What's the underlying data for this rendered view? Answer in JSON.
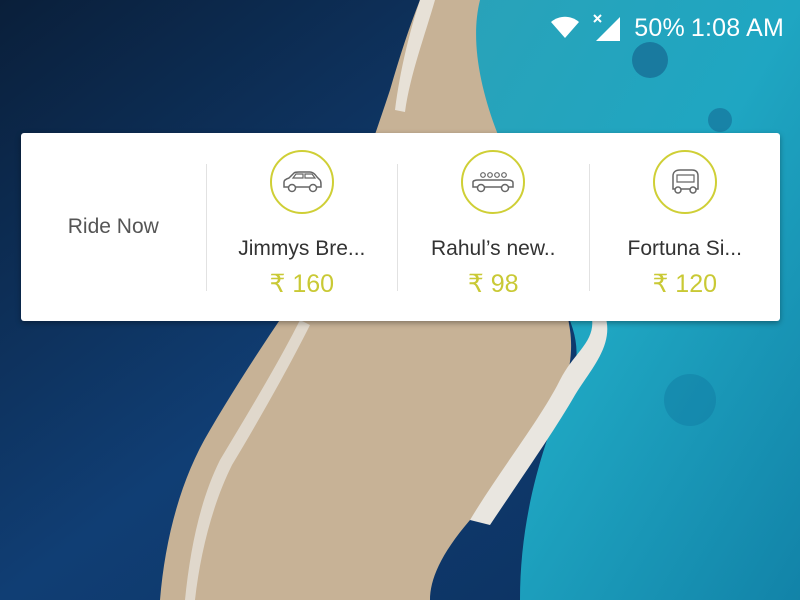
{
  "status_bar": {
    "battery": "50%",
    "time": "1:08 AM",
    "icons": [
      "wifi-icon",
      "cell-signal-icon"
    ]
  },
  "ride_card": {
    "label": "Ride Now",
    "options": [
      {
        "icon": "car-icon",
        "name": "Jimmys Bre...",
        "price": "₹ 160"
      },
      {
        "icon": "open-car-icon",
        "name": "Rahul’s new..",
        "price": "₹ 98"
      },
      {
        "icon": "auto-rickshaw-icon",
        "name": "Fortuna Si...",
        "price": "₹ 120"
      }
    ]
  },
  "colors": {
    "accent": "#c9c935",
    "card_bg": "#ffffff",
    "label_text": "#555555",
    "name_text": "#333333"
  }
}
